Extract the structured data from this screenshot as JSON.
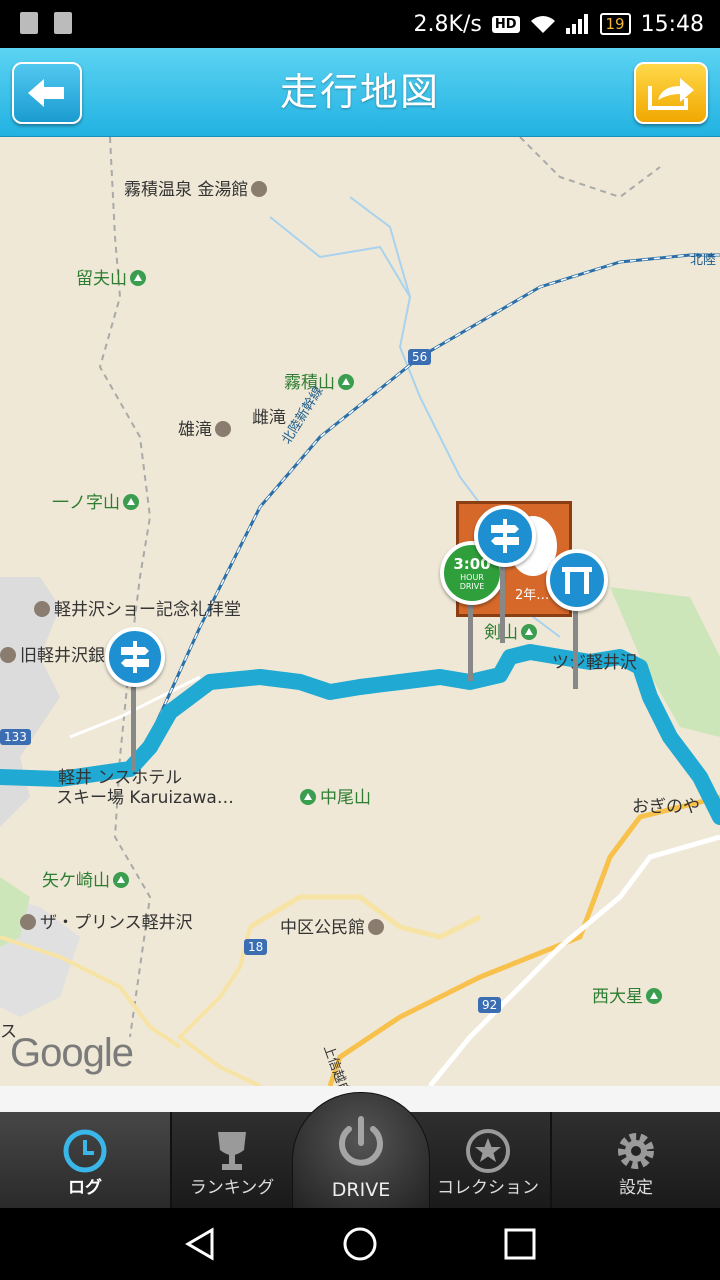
{
  "status_bar": {
    "speed": "2.8K/s",
    "hd": "HD",
    "battery": "19",
    "time": "15:48"
  },
  "header": {
    "title": "走行地図"
  },
  "map": {
    "labels": {
      "l1": "霧積温泉 金湯館",
      "l2": "留夫山",
      "l3": "霧積山",
      "l4": "雄滝",
      "l5": "雌滝",
      "l6": "一ノ字山",
      "l7": "軽井沢ショー記念礼拝堂",
      "l8": "旧軽井沢銀",
      "l9": "中尾山",
      "l10": "矢ケ崎山",
      "l11": "ザ・プリンス軽井沢",
      "l12": "中区公民館",
      "l13": "西大星",
      "l14": "おぎのや",
      "l15": "剣山",
      "l16": "軽井 ンスホテル",
      "l17": "スキー場 Karuizawa…",
      "l18": "北陸",
      "l19": "北陸新幹線",
      "l20": "ツジ軽井沢",
      "l21": "上信越自",
      "r56": "56",
      "r18": "18",
      "r92": "92",
      "r133": "133",
      "l22": "ス",
      "badge_3": "3:00",
      "badge_hour": "HOUR",
      "badge_drive": "DRIVE",
      "sign_year": "2年…"
    },
    "google": "Google"
  },
  "tabs": {
    "log": "ログ",
    "ranking": "ランキング",
    "drive": "DRIVE",
    "collection": "コレクション",
    "settings": "設定"
  },
  "colors": {
    "header": "#22b2e2",
    "route": "#1fa9d3",
    "share": "#f0a800"
  }
}
